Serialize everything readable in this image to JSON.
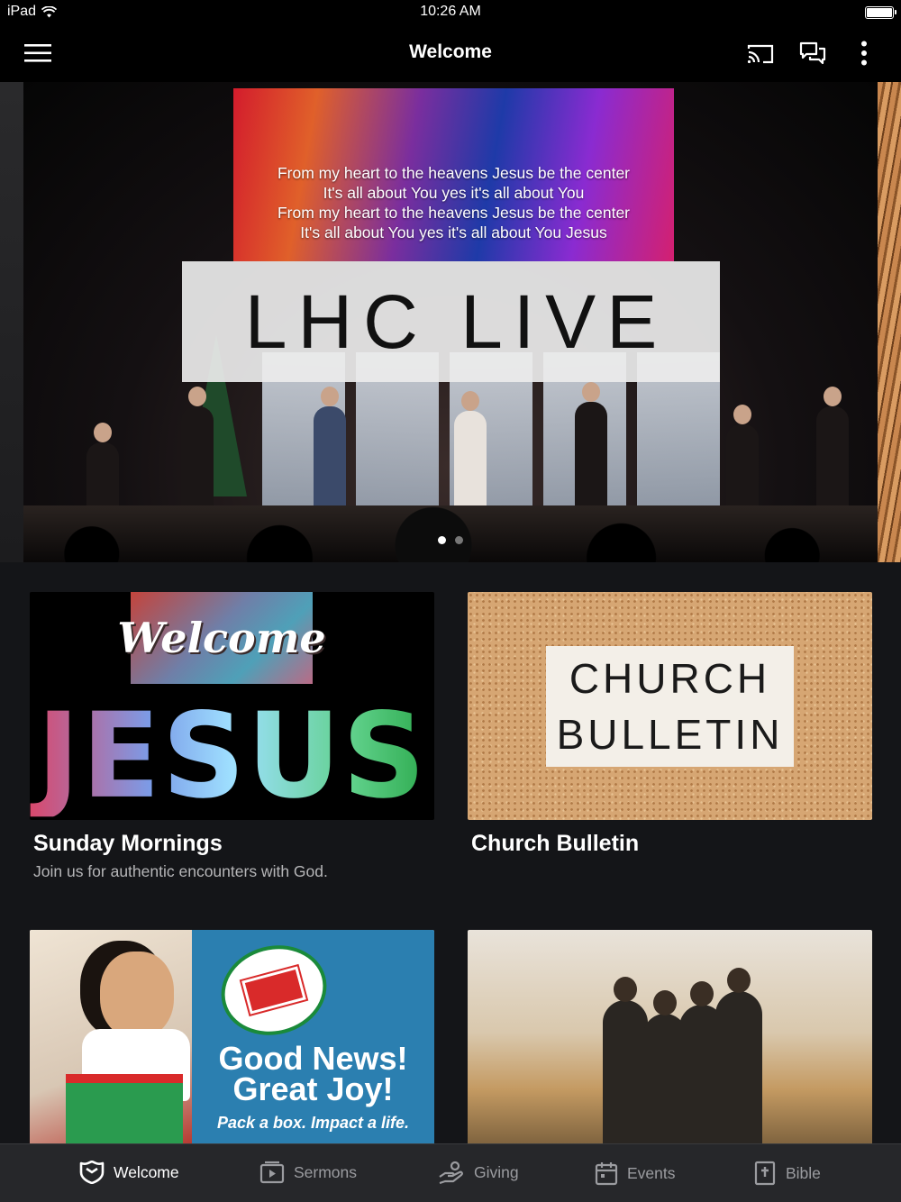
{
  "status_bar": {
    "device": "iPad",
    "time": "10:26 AM"
  },
  "nav": {
    "title": "Welcome",
    "icons": [
      "hamburger-menu-icon",
      "cast-icon",
      "chat-icon",
      "more-vertical-icon"
    ]
  },
  "hero": {
    "lyrics": [
      "From my heart to the heavens Jesus be the center",
      "It's all about You yes it's all about You",
      "From my heart to the heavens Jesus be the center",
      "It's all about You yes it's all about You Jesus"
    ],
    "banner": "LHC LIVE",
    "page_count": 2,
    "active_page": 1
  },
  "cards": [
    {
      "title": "Sunday Mornings",
      "subtitle": "Join us for authentic encounters with God.",
      "image_text": {
        "sign": "Welcome",
        "letters": "JESUS"
      }
    },
    {
      "title": "Church Bulletin",
      "image_text": {
        "line1": "CHURCH",
        "line2": "BULLETIN"
      }
    },
    {
      "image_text": {
        "logo": "Samaritan's Purse Operation Christmas Child",
        "headline1": "Good News!",
        "headline2": "Great Joy!",
        "tagline": "Pack a box. Impact a life."
      }
    },
    {}
  ],
  "tabs": [
    {
      "label": "Welcome",
      "icon": "shield-icon",
      "active": true
    },
    {
      "label": "Sermons",
      "icon": "play-icon",
      "active": false
    },
    {
      "label": "Giving",
      "icon": "giving-hand-icon",
      "active": false
    },
    {
      "label": "Events",
      "icon": "calendar-icon",
      "active": false
    },
    {
      "label": "Bible",
      "icon": "bible-icon",
      "active": false
    }
  ],
  "colors": {
    "background": "#141518",
    "tab_bar": "#26272a",
    "tab_inactive": "#9b9ca0",
    "tab_active": "#ffffff"
  }
}
